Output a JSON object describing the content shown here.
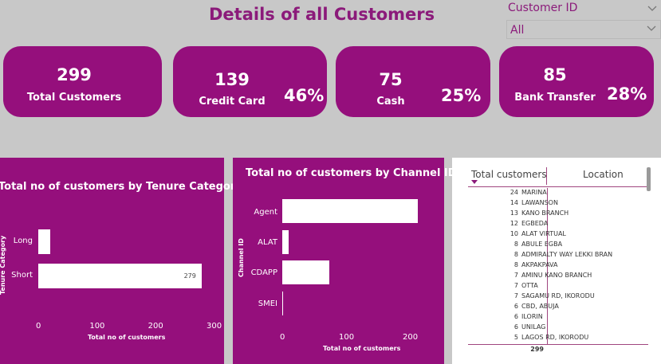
{
  "header": {
    "title": "Details of all Customers"
  },
  "slicer": {
    "label": "Customer ID",
    "value": "All"
  },
  "cards": [
    {
      "value": "299",
      "label": "Total Customers",
      "percent": ""
    },
    {
      "value": "139",
      "label": "Credit Card",
      "percent": "46%"
    },
    {
      "value": "75",
      "label": "Cash",
      "percent": "25%"
    },
    {
      "value": "85",
      "label": "Bank Transfer",
      "percent": "28%"
    }
  ],
  "tenure_chart": {
    "title": "Total no of customers by Tenure Category",
    "ylabel": "Tenure Category",
    "xlabel": "Total no of customers",
    "ticks": [
      "0",
      "100",
      "200",
      "300"
    ],
    "data_label_short": "279"
  },
  "channel_chart": {
    "title": "Total no of customers by Channel ID",
    "ylabel": "Channel ID",
    "xlabel": "Total no of customers",
    "ticks": [
      "0",
      "100",
      "200"
    ]
  },
  "chart_data": [
    {
      "type": "bar",
      "orientation": "horizontal",
      "title": "Total no of customers by Tenure Category",
      "categories": [
        "Long",
        "Short"
      ],
      "values": [
        20,
        279
      ],
      "xlabel": "Total no of customers",
      "ylabel": "Tenure Category",
      "xlim": [
        0,
        300
      ]
    },
    {
      "type": "bar",
      "orientation": "horizontal",
      "title": "Total no of customers by Channel ID",
      "categories": [
        "Agent",
        "ALAT",
        "CDAPP",
        "SMEI"
      ],
      "values": [
        213,
        10,
        74,
        1
      ],
      "xlabel": "Total no of customers",
      "ylabel": "Channel ID",
      "xlim": [
        0,
        200
      ]
    }
  ],
  "table": {
    "col_customers": "Total customers",
    "col_location": "Location",
    "rows": [
      {
        "n": "24",
        "loc": "MARINA"
      },
      {
        "n": "14",
        "loc": "LAWANSON"
      },
      {
        "n": "13",
        "loc": "KANO BRANCH"
      },
      {
        "n": "12",
        "loc": "EGBEDA"
      },
      {
        "n": "10",
        "loc": "ALAT VIRTUAL"
      },
      {
        "n": "8",
        "loc": "ABULE EGBA"
      },
      {
        "n": "8",
        "loc": "ADMIRALTY WAY LEKKI BRAN"
      },
      {
        "n": "8",
        "loc": "AKPAKPAVA"
      },
      {
        "n": "7",
        "loc": "AMINU KANO BRANCH"
      },
      {
        "n": "7",
        "loc": "OTTA"
      },
      {
        "n": "7",
        "loc": "SAGAMU RD, IKORODU"
      },
      {
        "n": "6",
        "loc": "CBD, ABUJA"
      },
      {
        "n": "6",
        "loc": "ILORIN"
      },
      {
        "n": "6",
        "loc": "UNILAG"
      },
      {
        "n": "5",
        "loc": "LAGOS RD, IKORODU"
      }
    ],
    "total": "299"
  },
  "colors": {
    "accent": "#950f7c",
    "title": "#8b1a7a",
    "background": "#c8c8c8"
  }
}
